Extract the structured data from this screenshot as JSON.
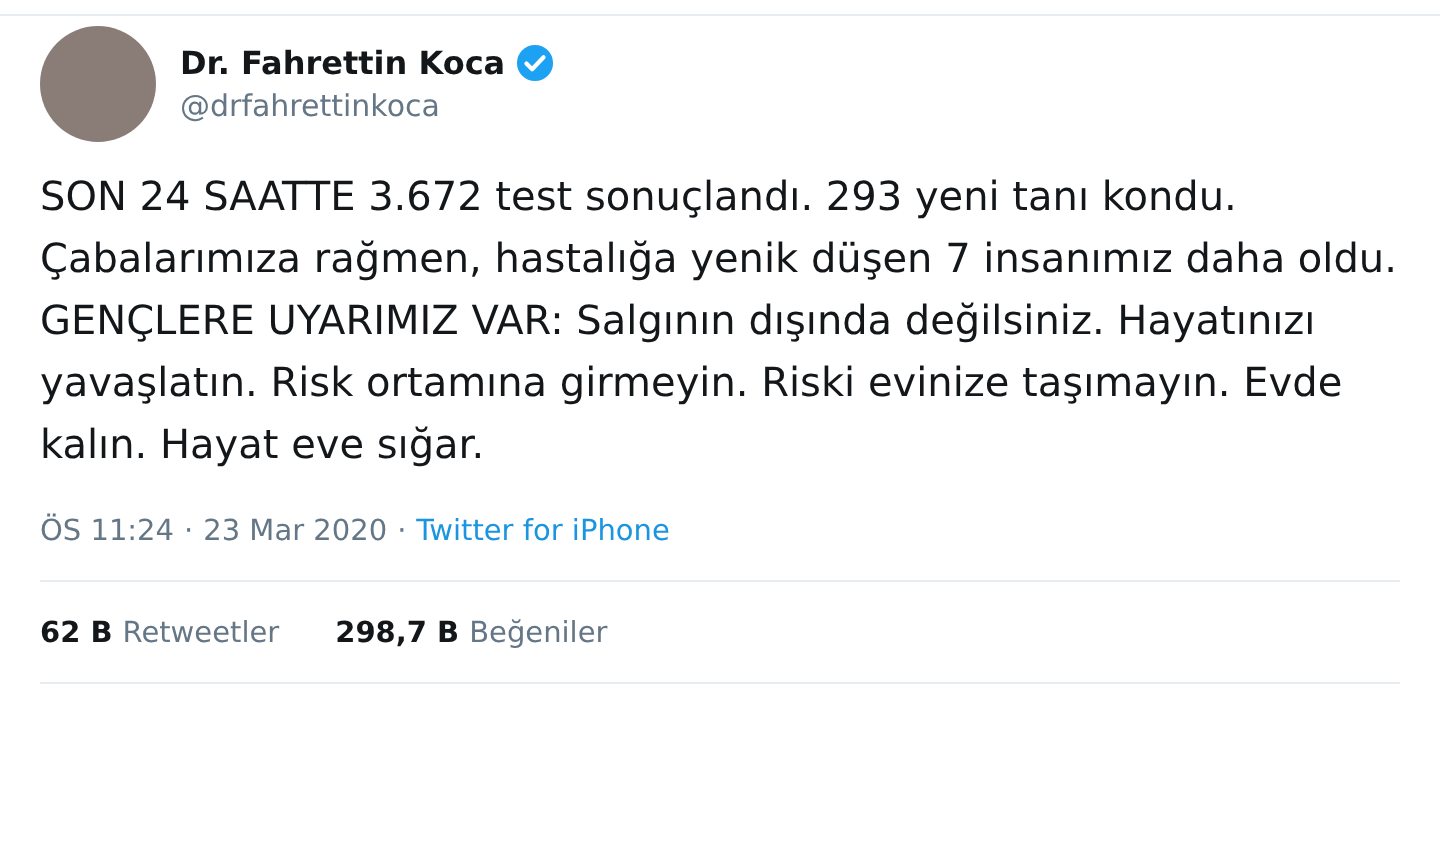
{
  "author": {
    "name": "Dr. Fahrettin Koca",
    "verified": true,
    "handle": "@drfahrettinkoca"
  },
  "text": "SON 24 SAATTE 3.672 test sonuçlandı. 293 yeni tanı kondu. Çabalarımıza rağmen, hastalığa yenik düşen 7 insanımız daha oldu. GENÇLERE UYARIMIZ VAR: Salgının dışında değilsiniz. Hayatınızı yavaşlatın. Risk ortamına girmeyin. Riski evinize taşımayın. Evde kalın. Hayat eve sığar.",
  "meta": {
    "time": "ÖS 11:24",
    "separator_1": "·",
    "date": "23 Mar 2020",
    "separator_2": "·",
    "source": "Twitter for iPhone"
  },
  "stats": [
    {
      "count": "62 B",
      "label": "Retweetler"
    },
    {
      "count": "298,7 B",
      "label": "Beğeniler"
    }
  ]
}
